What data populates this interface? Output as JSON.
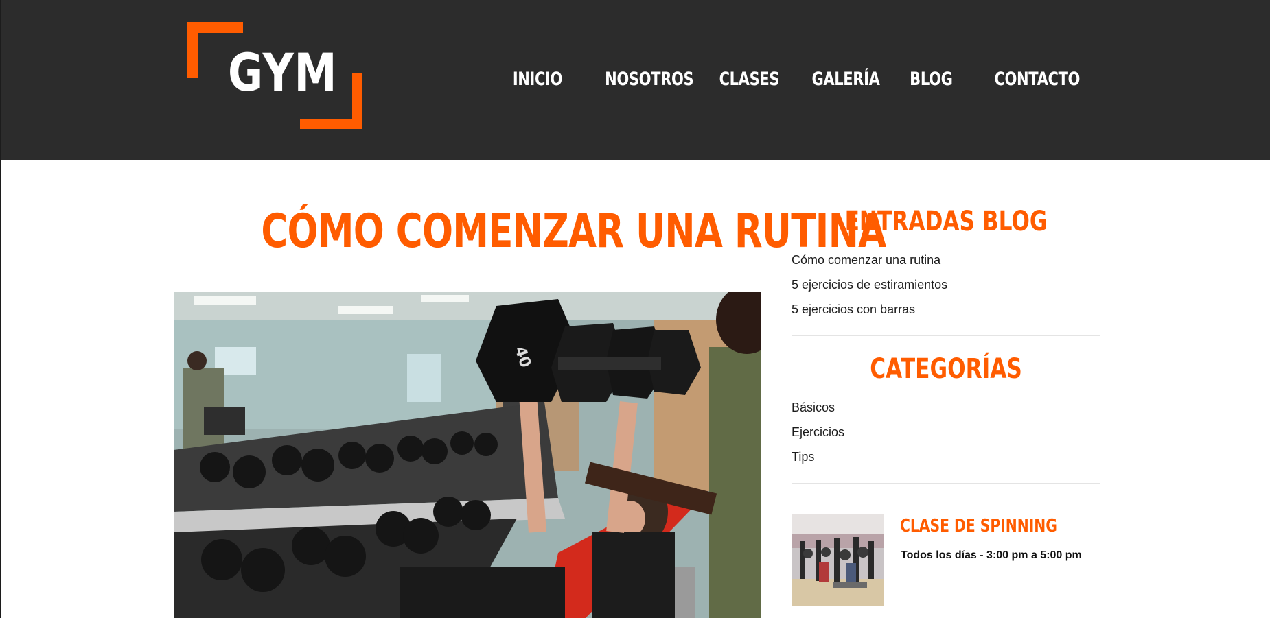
{
  "site": {
    "logo_text": "GYM",
    "brand_color": "#ff5c00",
    "header_bg": "#2c2c2c"
  },
  "nav": {
    "items": [
      {
        "label": "INICIO"
      },
      {
        "label": "NOSOTROS"
      },
      {
        "label": "CLASES"
      },
      {
        "label": "GALERÍA"
      },
      {
        "label": "BLOG"
      },
      {
        "label": "CONTACTO"
      }
    ]
  },
  "post": {
    "title": "CÓMO COMENZAR UNA RUTINA"
  },
  "sidebar": {
    "entries_heading": "ENTRADAS BLOG",
    "entries": [
      {
        "label": "Cómo comenzar una rutina"
      },
      {
        "label": "5 ejercicios de estiramientos"
      },
      {
        "label": "5 ejercicios con barras"
      }
    ],
    "categories_heading": "CATEGORÍAS",
    "categories": [
      {
        "label": "Básicos"
      },
      {
        "label": "Ejercicios"
      },
      {
        "label": "Tips"
      }
    ],
    "class_card": {
      "title": "CLASE DE SPINNING",
      "schedule": "Todos los días - 3:00 pm a 5:00 pm"
    }
  }
}
